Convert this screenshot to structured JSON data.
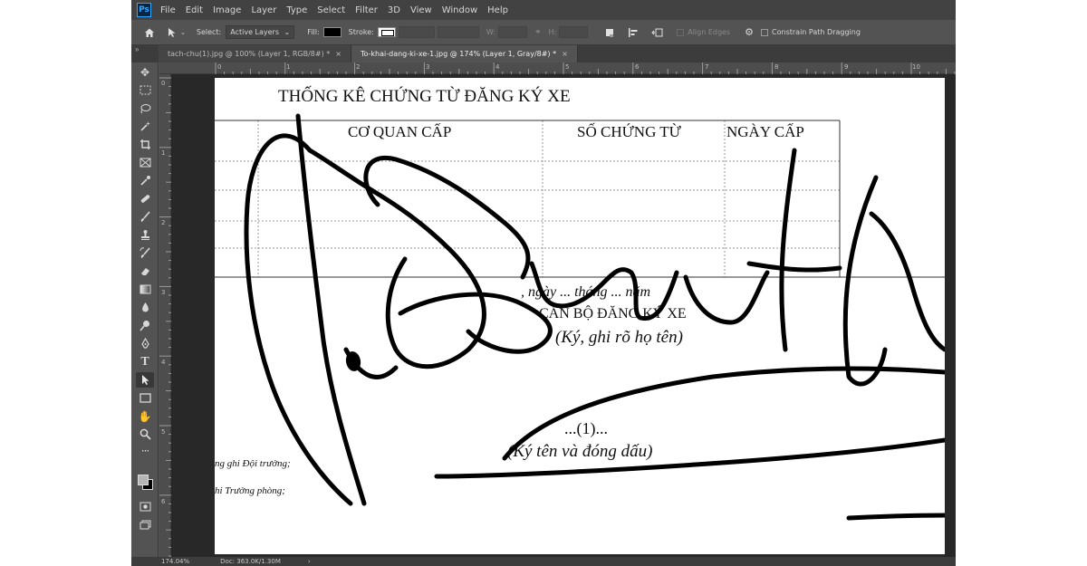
{
  "app": {
    "logo": "Ps"
  },
  "menu": [
    "File",
    "Edit",
    "Image",
    "Layer",
    "Type",
    "Select",
    "Filter",
    "3D",
    "View",
    "Window",
    "Help"
  ],
  "options": {
    "select_label": "Select:",
    "select_value": "Active Layers",
    "fill_label": "Fill:",
    "stroke_label": "Stroke:",
    "w_label": "W:",
    "h_label": "H:",
    "align_edges": "Align Edges",
    "constrain": "Constrain Path Dragging",
    "icons": [
      "home-icon",
      "path-selection-icon",
      "gear-icon"
    ]
  },
  "tabs": [
    {
      "label": "tach-chu(1).jpg @ 100% (Layer 1, RGB/8#) *",
      "active": false
    },
    {
      "label": "To-khai-dang-ki-xe-1.jpg @ 174% (Layer 1, Gray/8#) *",
      "active": true
    }
  ],
  "ruler": {
    "h": [
      "0",
      "1",
      "2",
      "3",
      "4",
      "5",
      "6",
      "7",
      "8",
      "9",
      "10"
    ],
    "v": [
      "0",
      "1",
      "2",
      "3",
      "4",
      "5",
      "6"
    ]
  },
  "document": {
    "title": "THỐNG KÊ CHỨNG TỪ ĐĂNG KÝ XE",
    "headers": [
      "CƠ QUAN CẤP",
      "SỐ CHỨNG TỪ",
      "NGÀY CẤP"
    ],
    "date_line": ", ngày ... tháng ... năm",
    "officer": "CÁN BỘ ĐĂNG KÝ XE",
    "sign_note": "(Ký, ghi rõ họ tên)",
    "ref": "...(1)...",
    "seal_note": "(Ký tên và đóng dấu)",
    "left_line_1": "ng ghi Đội trưởng;",
    "left_line_2": "hi Trưởng phòng;"
  },
  "status": {
    "zoom": "174.04%",
    "doc": "Doc: 363.0K/1.30M"
  }
}
